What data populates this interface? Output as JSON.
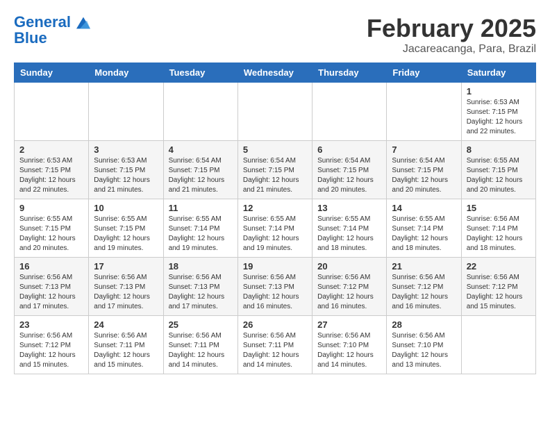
{
  "logo": {
    "line1": "General",
    "line2": "Blue"
  },
  "title": "February 2025",
  "location": "Jacareacanga, Para, Brazil",
  "weekdays": [
    "Sunday",
    "Monday",
    "Tuesday",
    "Wednesday",
    "Thursday",
    "Friday",
    "Saturday"
  ],
  "weeks": [
    [
      {
        "day": "",
        "info": ""
      },
      {
        "day": "",
        "info": ""
      },
      {
        "day": "",
        "info": ""
      },
      {
        "day": "",
        "info": ""
      },
      {
        "day": "",
        "info": ""
      },
      {
        "day": "",
        "info": ""
      },
      {
        "day": "1",
        "info": "Sunrise: 6:53 AM\nSunset: 7:15 PM\nDaylight: 12 hours\nand 22 minutes."
      }
    ],
    [
      {
        "day": "2",
        "info": "Sunrise: 6:53 AM\nSunset: 7:15 PM\nDaylight: 12 hours\nand 22 minutes."
      },
      {
        "day": "3",
        "info": "Sunrise: 6:53 AM\nSunset: 7:15 PM\nDaylight: 12 hours\nand 21 minutes."
      },
      {
        "day": "4",
        "info": "Sunrise: 6:54 AM\nSunset: 7:15 PM\nDaylight: 12 hours\nand 21 minutes."
      },
      {
        "day": "5",
        "info": "Sunrise: 6:54 AM\nSunset: 7:15 PM\nDaylight: 12 hours\nand 21 minutes."
      },
      {
        "day": "6",
        "info": "Sunrise: 6:54 AM\nSunset: 7:15 PM\nDaylight: 12 hours\nand 20 minutes."
      },
      {
        "day": "7",
        "info": "Sunrise: 6:54 AM\nSunset: 7:15 PM\nDaylight: 12 hours\nand 20 minutes."
      },
      {
        "day": "8",
        "info": "Sunrise: 6:55 AM\nSunset: 7:15 PM\nDaylight: 12 hours\nand 20 minutes."
      }
    ],
    [
      {
        "day": "9",
        "info": "Sunrise: 6:55 AM\nSunset: 7:15 PM\nDaylight: 12 hours\nand 20 minutes."
      },
      {
        "day": "10",
        "info": "Sunrise: 6:55 AM\nSunset: 7:15 PM\nDaylight: 12 hours\nand 19 minutes."
      },
      {
        "day": "11",
        "info": "Sunrise: 6:55 AM\nSunset: 7:14 PM\nDaylight: 12 hours\nand 19 minutes."
      },
      {
        "day": "12",
        "info": "Sunrise: 6:55 AM\nSunset: 7:14 PM\nDaylight: 12 hours\nand 19 minutes."
      },
      {
        "day": "13",
        "info": "Sunrise: 6:55 AM\nSunset: 7:14 PM\nDaylight: 12 hours\nand 18 minutes."
      },
      {
        "day": "14",
        "info": "Sunrise: 6:55 AM\nSunset: 7:14 PM\nDaylight: 12 hours\nand 18 minutes."
      },
      {
        "day": "15",
        "info": "Sunrise: 6:56 AM\nSunset: 7:14 PM\nDaylight: 12 hours\nand 18 minutes."
      }
    ],
    [
      {
        "day": "16",
        "info": "Sunrise: 6:56 AM\nSunset: 7:13 PM\nDaylight: 12 hours\nand 17 minutes."
      },
      {
        "day": "17",
        "info": "Sunrise: 6:56 AM\nSunset: 7:13 PM\nDaylight: 12 hours\nand 17 minutes."
      },
      {
        "day": "18",
        "info": "Sunrise: 6:56 AM\nSunset: 7:13 PM\nDaylight: 12 hours\nand 17 minutes."
      },
      {
        "day": "19",
        "info": "Sunrise: 6:56 AM\nSunset: 7:13 PM\nDaylight: 12 hours\nand 16 minutes."
      },
      {
        "day": "20",
        "info": "Sunrise: 6:56 AM\nSunset: 7:12 PM\nDaylight: 12 hours\nand 16 minutes."
      },
      {
        "day": "21",
        "info": "Sunrise: 6:56 AM\nSunset: 7:12 PM\nDaylight: 12 hours\nand 16 minutes."
      },
      {
        "day": "22",
        "info": "Sunrise: 6:56 AM\nSunset: 7:12 PM\nDaylight: 12 hours\nand 15 minutes."
      }
    ],
    [
      {
        "day": "23",
        "info": "Sunrise: 6:56 AM\nSunset: 7:12 PM\nDaylight: 12 hours\nand 15 minutes."
      },
      {
        "day": "24",
        "info": "Sunrise: 6:56 AM\nSunset: 7:11 PM\nDaylight: 12 hours\nand 15 minutes."
      },
      {
        "day": "25",
        "info": "Sunrise: 6:56 AM\nSunset: 7:11 PM\nDaylight: 12 hours\nand 14 minutes."
      },
      {
        "day": "26",
        "info": "Sunrise: 6:56 AM\nSunset: 7:11 PM\nDaylight: 12 hours\nand 14 minutes."
      },
      {
        "day": "27",
        "info": "Sunrise: 6:56 AM\nSunset: 7:10 PM\nDaylight: 12 hours\nand 14 minutes."
      },
      {
        "day": "28",
        "info": "Sunrise: 6:56 AM\nSunset: 7:10 PM\nDaylight: 12 hours\nand 13 minutes."
      },
      {
        "day": "",
        "info": ""
      }
    ]
  ]
}
